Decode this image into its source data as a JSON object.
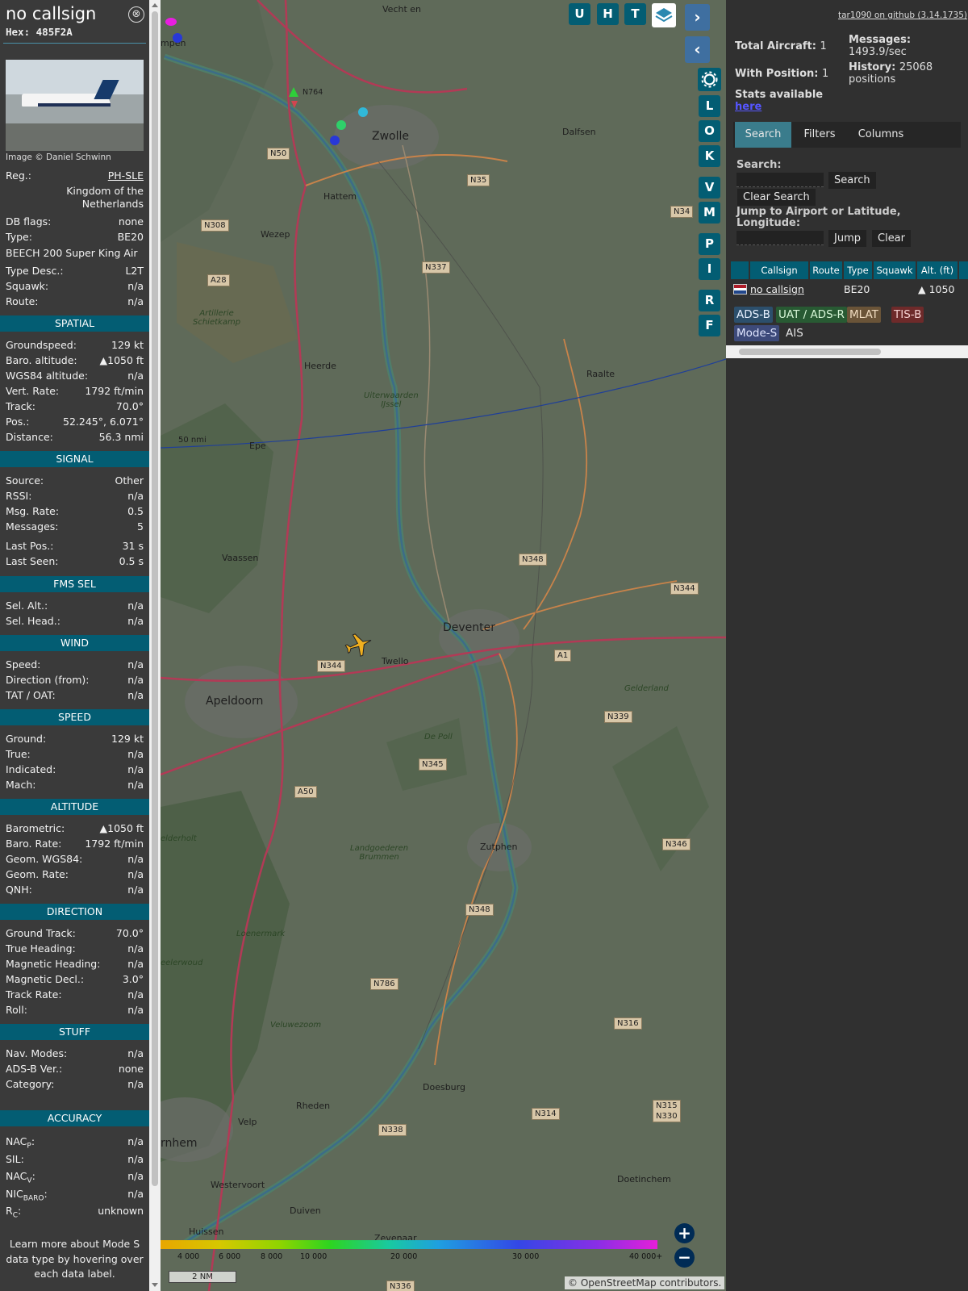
{
  "aircraft": {
    "callsign": "no callsign",
    "hex_label": "Hex:",
    "hex": "485F2A",
    "close_glyph": "⊗",
    "photo_credit": "Image © Daniel Schwinn",
    "reg_label": "Reg.:",
    "reg": "PH-SLE",
    "country_line1": "Kingdom of the",
    "country_line2": "Netherlands",
    "dbflags_label": "DB flags:",
    "dbflags": "none",
    "type_label": "Type:",
    "type": "BE20",
    "type_full": "BEECH 200 Super King Air",
    "typedesc_label": "Type Desc.:",
    "typedesc": "L2T",
    "squawk_label": "Squawk:",
    "squawk": "n/a",
    "route_label": "Route:",
    "route": "n/a"
  },
  "sections": {
    "spatial": "SPATIAL",
    "signal": "SIGNAL",
    "fms": "FMS SEL",
    "wind": "WIND",
    "speed": "SPEED",
    "altitude": "ALTITUDE",
    "direction": "DIRECTION",
    "stuff": "STUFF",
    "accuracy": "ACCURACY"
  },
  "spatial": [
    {
      "k": "Groundspeed:",
      "v": "129 kt"
    },
    {
      "k": "Baro. altitude:",
      "v": "▲1050 ft"
    },
    {
      "k": "WGS84 altitude:",
      "v": "n/a"
    },
    {
      "k": "Vert. Rate:",
      "v": "1792 ft/min"
    },
    {
      "k": "Track:",
      "v": "70.0°"
    },
    {
      "k": "Pos.:",
      "v": "52.245°, 6.071°"
    },
    {
      "k": "Distance:",
      "v": "56.3 nmi"
    }
  ],
  "signal": [
    {
      "k": "Source:",
      "v": "Other"
    },
    {
      "k": "RSSI:",
      "v": "n/a"
    },
    {
      "k": "Msg. Rate:",
      "v": "0.5"
    },
    {
      "k": "Messages:",
      "v": "5"
    },
    {
      "k": "Last Pos.:",
      "v": "31 s"
    },
    {
      "k": "Last Seen:",
      "v": "0.5 s"
    }
  ],
  "fms": [
    {
      "k": "Sel. Alt.:",
      "v": "n/a"
    },
    {
      "k": "Sel. Head.:",
      "v": "n/a"
    }
  ],
  "wind": [
    {
      "k": "Speed:",
      "v": "n/a"
    },
    {
      "k": "Direction (from):",
      "v": "n/a"
    },
    {
      "k": "TAT / OAT:",
      "v": "n/a"
    }
  ],
  "speed": [
    {
      "k": "Ground:",
      "v": "129 kt"
    },
    {
      "k": "True:",
      "v": "n/a"
    },
    {
      "k": "Indicated:",
      "v": "n/a"
    },
    {
      "k": "Mach:",
      "v": "n/a"
    }
  ],
  "altitude": [
    {
      "k": "Barometric:",
      "v": "▲1050 ft"
    },
    {
      "k": "Baro. Rate:",
      "v": "1792 ft/min"
    },
    {
      "k": "Geom. WGS84:",
      "v": "n/a"
    },
    {
      "k": "Geom. Rate:",
      "v": "n/a"
    },
    {
      "k": "QNH:",
      "v": "n/a"
    }
  ],
  "direction": [
    {
      "k": "Ground Track:",
      "v": "70.0°"
    },
    {
      "k": "True Heading:",
      "v": "n/a"
    },
    {
      "k": "Magnetic Heading:",
      "v": "n/a"
    },
    {
      "k": "Magnetic Decl.:",
      "v": "3.0°"
    },
    {
      "k": "Track Rate:",
      "v": "n/a"
    },
    {
      "k": "Roll:",
      "v": "n/a"
    }
  ],
  "stuff": [
    {
      "k": "Nav. Modes:",
      "v": "n/a"
    },
    {
      "k": "ADS-B Ver.:",
      "v": "none"
    },
    {
      "k": "Category:",
      "v": "n/a"
    }
  ],
  "accuracy": [
    {
      "k": "NAC",
      "sub": "P",
      "v": "n/a"
    },
    {
      "k": "SIL:",
      "sub": "",
      "v": "n/a"
    },
    {
      "k": "NAC",
      "sub": "V",
      "v": "n/a"
    },
    {
      "k": "NIC",
      "sub": "BARO",
      "v": "n/a"
    },
    {
      "k": "R",
      "sub": "C",
      "v": "unknown"
    }
  ],
  "footer": [
    "Learn more about Mode S",
    "data type by hovering over",
    "each data label."
  ],
  "map": {
    "buttons": [
      "U",
      "H",
      "T"
    ],
    "side_buttons": [
      "L",
      "O",
      "K",
      "V",
      "M",
      "P",
      "I",
      "R",
      "F"
    ],
    "places": [
      {
        "t": "Zwolle",
        "cls": "big"
      },
      {
        "t": "Hattem"
      },
      {
        "t": "Wezep"
      },
      {
        "t": "Dalfsen"
      },
      {
        "t": "Heerde"
      },
      {
        "t": "Raalte"
      },
      {
        "t": "Epe"
      },
      {
        "t": "Vaassen"
      },
      {
        "t": "Deventer",
        "cls": "big"
      },
      {
        "t": "Twello"
      },
      {
        "t": "Apeldoorn",
        "cls": "big"
      },
      {
        "t": "Zutphen"
      },
      {
        "t": "Doesburg"
      },
      {
        "t": "Rheden"
      },
      {
        "t": "Velp"
      },
      {
        "t": "rnhem",
        "cls": "big"
      },
      {
        "t": "Westervoort"
      },
      {
        "t": "Duiven"
      },
      {
        "t": "Doetinchem"
      },
      {
        "t": "Zevenaar"
      },
      {
        "t": "Huissen"
      },
      {
        "t": "mpen"
      },
      {
        "t": "Vecht en"
      }
    ],
    "naturelabels": [
      {
        "t": "Artillerie\nSchietkamp"
      },
      {
        "t": "Uiterwaarden\nIJssel"
      },
      {
        "t": "De Poll"
      },
      {
        "t": "Landgoederen\nBrummen"
      },
      {
        "t": "Loenermark"
      },
      {
        "t": "Veluwezoom"
      },
      {
        "t": "eelerwoud"
      },
      {
        "t": "elderholt"
      },
      {
        "t": "Gelderland"
      }
    ],
    "roads": [
      "N50",
      "N35",
      "N308",
      "N337",
      "A28",
      "N348",
      "N344",
      "N344",
      "A1",
      "N339",
      "N345",
      "A50",
      "N346",
      "N348",
      "N786",
      "N316",
      "N314",
      "N315\nN330",
      "N338",
      "N336",
      "N34",
      "N764"
    ],
    "range_label": "50 nmi",
    "colorbar_ticks": [
      "4 000",
      "6 000",
      "8 000",
      "10 000",
      "20 000",
      "30 000",
      "40 000+"
    ],
    "scale": "2 NM",
    "attribution_prefix": "© ",
    "attribution_link": "OpenStreetMap",
    "attribution_suffix": " contributors."
  },
  "right": {
    "github": "tar1090 on github (3.14.1735)",
    "total_label": "Total Aircraft:",
    "total": "1",
    "withpos_label": "With Position:",
    "withpos": "1",
    "msgs_label": "Messages:",
    "msgs": "1493.9/sec",
    "history_label": "History:",
    "history_value": "25068",
    "history_unit": "positions",
    "stats_label": "Stats available",
    "stats_link": "here",
    "tabs": [
      "Search",
      "Filters",
      "Columns"
    ],
    "search_label": "Search:",
    "search_btn": "Search",
    "clear_search": "Clear Search",
    "jump_label_1": "Jump to Airport or Latitude,",
    "jump_label_2": "Longitude:",
    "jump_btn": "Jump",
    "clear_btn": "Clear",
    "columns": [
      "Callsign",
      "Route",
      "Type",
      "Squawk",
      "Alt. (ft)"
    ],
    "row": {
      "callsign": "no callsign",
      "type": "BE20",
      "alt": "▲ 1050"
    },
    "legend": [
      {
        "t": "ADS-B",
        "bg": "#2c4f6c",
        "fg": "#e6f0ff"
      },
      {
        "t": "UAT / ADS-R",
        "bg": "#285a33",
        "fg": "#d6f5d6"
      },
      {
        "t": "MLAT",
        "bg": "#6a5438",
        "fg": "#f0dcc0"
      },
      {
        "t": "TIS-B",
        "bg": "#6e2a2a",
        "fg": "#f5d0d0"
      },
      {
        "t": "Mode-S",
        "bg": "#3d4a7a",
        "fg": "#e0e6ff"
      },
      {
        "t": "AIS",
        "bg": "transparent",
        "fg": "#e6e6e6"
      }
    ]
  }
}
